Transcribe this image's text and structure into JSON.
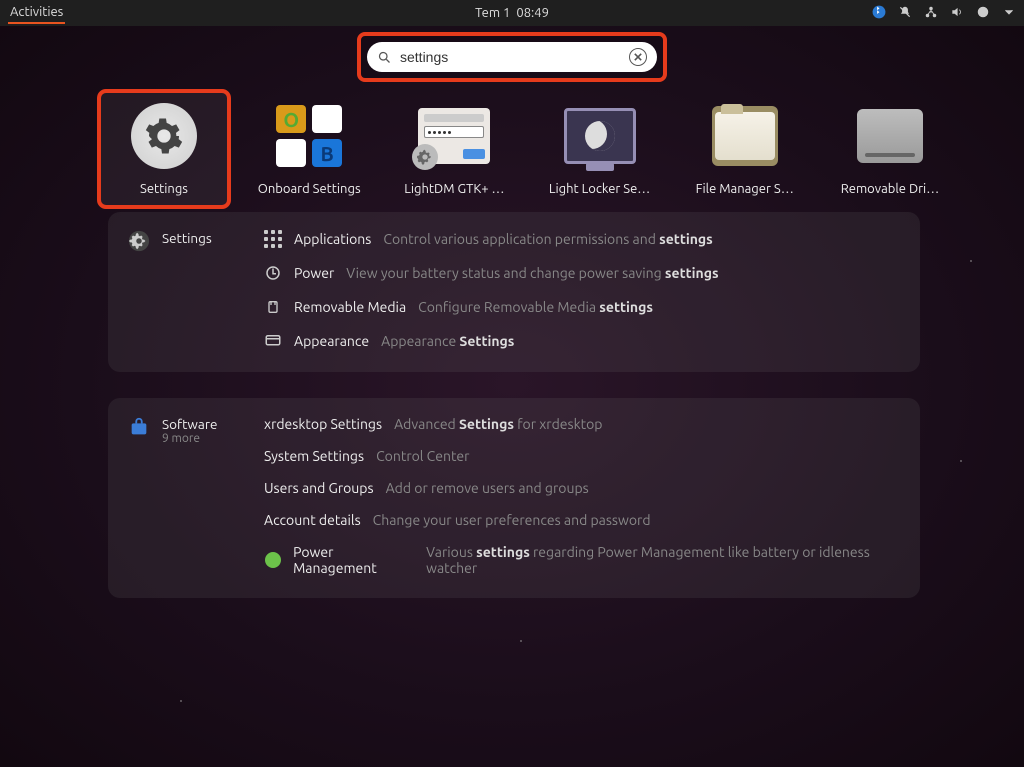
{
  "topbar": {
    "activities": "Activities",
    "date": "Tem 1",
    "time": "08:49"
  },
  "search": {
    "value": "settings"
  },
  "apps": [
    {
      "label": "Settings"
    },
    {
      "label": "Onboard Settings"
    },
    {
      "label": "LightDM GTK+ …"
    },
    {
      "label": "Light Locker Se…"
    },
    {
      "label": "File Manager S…"
    },
    {
      "label": "Removable Dri…"
    }
  ],
  "settings_section": {
    "title": "Settings",
    "items": [
      {
        "name": "Applications",
        "desc": "Control various application permissions and ",
        "bold": "settings"
      },
      {
        "name": "Power",
        "desc": "View your battery status and change power saving ",
        "bold": "settings"
      },
      {
        "name": "Removable Media",
        "desc": "Configure Removable Media ",
        "bold": "settings"
      },
      {
        "name": "Appearance",
        "desc": "Appearance ",
        "bold": "Settings"
      }
    ]
  },
  "software_section": {
    "title": "Software",
    "subtitle": "9 more",
    "items": [
      {
        "name": "xrdesktop Settings",
        "desc1": "Advanced ",
        "bold": "Settings",
        "desc2": " for xrdesktop"
      },
      {
        "name": "System Settings",
        "desc1": "Control Center",
        "bold": "",
        "desc2": ""
      },
      {
        "name": "Users and Groups",
        "desc1": "Add or remove users and groups",
        "bold": "",
        "desc2": ""
      },
      {
        "name": "Account details",
        "desc1": "Change your user preferences and password",
        "bold": "",
        "desc2": ""
      },
      {
        "name": "Power Management",
        "desc1": "Various ",
        "bold": "settings",
        "desc2": " regarding Power Management like battery or idleness watcher"
      }
    ]
  }
}
